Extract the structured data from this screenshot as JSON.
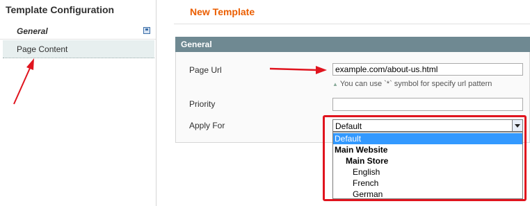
{
  "sidebar": {
    "title": "Template Configuration",
    "tabs": [
      {
        "label": "General"
      },
      {
        "label": "Page Content"
      }
    ]
  },
  "main": {
    "title": "New Template",
    "panel_title": "General",
    "fields": {
      "page_url": {
        "label": "Page Url",
        "value": "example.com/about-us.html",
        "hint": "You can use `*` symbol for specify url pattern"
      },
      "priority": {
        "label": "Priority",
        "value": ""
      },
      "apply_for": {
        "label": "Apply For",
        "selected": "Default",
        "options": [
          {
            "label": "Default",
            "level": 0,
            "bold": false,
            "selected": true
          },
          {
            "label": "Main Website",
            "level": 0,
            "bold": true,
            "selected": false
          },
          {
            "label": "Main Store",
            "level": 1,
            "bold": true,
            "selected": false
          },
          {
            "label": "English",
            "level": 2,
            "bold": false,
            "selected": false
          },
          {
            "label": "French",
            "level": 2,
            "bold": false,
            "selected": false
          },
          {
            "label": "German",
            "level": 2,
            "bold": false,
            "selected": false
          }
        ]
      }
    }
  },
  "colors": {
    "accent": "#eb5e00",
    "panel_header": "#6f8992",
    "annotation": "#e0141e",
    "selection": "#3399ff"
  }
}
